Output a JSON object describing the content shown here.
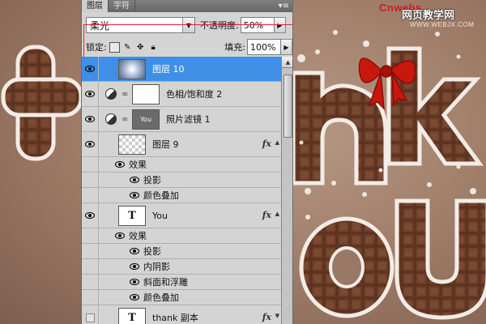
{
  "watermark": {
    "brand": "Cnwebs",
    "site_cn": "网页教学网",
    "domain": "WWW.WEBJX.COM"
  },
  "panel": {
    "tabs": [
      {
        "label": "图层",
        "active": true
      },
      {
        "label": "字符",
        "active": false
      }
    ],
    "blend_mode": "柔光",
    "opacity_label": "不透明度:",
    "opacity_value": "50%",
    "lock_label": "锁定:",
    "fill_label": "填充:",
    "fill_value": "100%"
  },
  "layers": [
    {
      "name": "图层 10",
      "selected": true,
      "visible": true
    },
    {
      "name": "色相/饱和度 2",
      "visible": true
    },
    {
      "name": "照片滤镜 1",
      "visible": true,
      "thumb_text": "You"
    },
    {
      "name": "图层 9",
      "visible": true,
      "effects_label": "效果",
      "effects": [
        "投影",
        "颜色叠加"
      ]
    },
    {
      "name": "You",
      "visible": true,
      "thumb_text": "T",
      "effects_label": "效果",
      "effects": [
        "投影",
        "内阴影",
        "斜面和浮雕",
        "颜色叠加"
      ]
    },
    {
      "name": "thank 副本",
      "visible": false,
      "thumb_text": "T"
    }
  ],
  "fx_label": "fx",
  "colors": {
    "selection": "#3f8fe6",
    "highlight_box": "#e3262e",
    "chocolate": "#5a2f1c",
    "bow": "#c8180e"
  }
}
